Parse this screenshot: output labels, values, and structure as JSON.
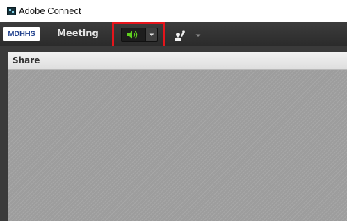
{
  "window": {
    "title": "Adobe Connect",
    "icon": "adobe-connect-icon"
  },
  "toolbar": {
    "logo_text": "MDHHS",
    "menu_meeting": "Meeting",
    "speaker_icon": "speaker-icon",
    "speaker_active_color": "#5fd01e",
    "dropdown_icon": "triangle-down-icon",
    "raise_hand_icon": "raise-hand-icon"
  },
  "pod": {
    "title": "Share"
  },
  "colors": {
    "toolbar": "#333333",
    "highlight": "#e5141b",
    "pod_header": "#e8e8e8",
    "pod_body": "#9d9d9d"
  }
}
